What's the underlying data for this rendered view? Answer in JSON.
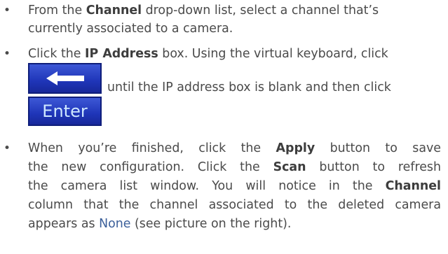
{
  "bullets": [
    {
      "symbol": "•",
      "line1": {
        "pre": "From the ",
        "bold": "Channel",
        "post": " drop-down list, select a channel that’s"
      },
      "line2": "currently associated to a camera."
    },
    {
      "symbol": "•",
      "line1": {
        "pre": "Click the ",
        "bold": "IP Address",
        "post": " box. Using the virtual keyboard, click"
      },
      "line2": "until the IP address box is blank and then click"
    },
    {
      "symbol": "•",
      "line1": {
        "pre": "When you’re finished, click the ",
        "bold": "Apply",
        "post": " button to save"
      },
      "line2": {
        "pre": "the new configuration. Click the ",
        "bold": "Scan",
        "post": " button to refresh"
      },
      "line3": {
        "pre": "the camera list window. You will notice in the ",
        "bold": "Channel"
      },
      "line4": "column that the channel associated to the deleted camera",
      "line5": {
        "pre": "appears as ",
        "link": "None",
        "post": " (see picture on the right)."
      }
    }
  ],
  "keys": {
    "backspace_icon": "left-arrow-icon",
    "enter_label": "Enter"
  },
  "colors": {
    "text": "#4a4a4a",
    "link": "#3b5f9a",
    "key_blue": "#1f35b8"
  }
}
